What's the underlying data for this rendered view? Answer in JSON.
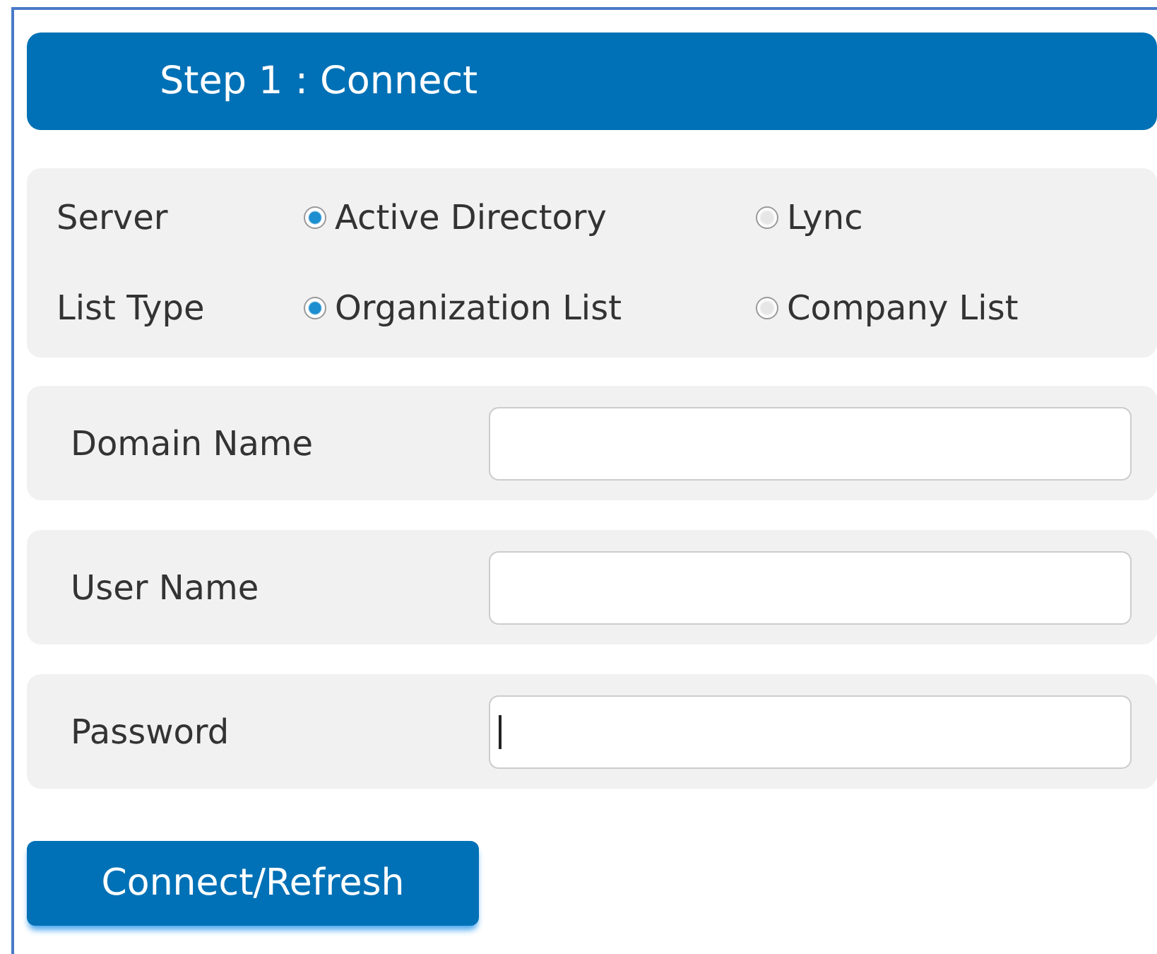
{
  "header": {
    "title": "Step 1 : Connect"
  },
  "radio_groups": [
    {
      "label": "Server",
      "options": [
        {
          "label": "Active Directory",
          "selected": true
        },
        {
          "label": "Lync",
          "selected": false
        }
      ]
    },
    {
      "label": "List Type",
      "options": [
        {
          "label": "Organization List",
          "selected": true
        },
        {
          "label": "Company List",
          "selected": false
        }
      ]
    }
  ],
  "fields": [
    {
      "label": "Domain Name",
      "focused": false
    },
    {
      "label": "User Name",
      "focused": false
    },
    {
      "label": "Password",
      "focused": true
    }
  ],
  "button": {
    "label": "Connect/Refresh"
  }
}
